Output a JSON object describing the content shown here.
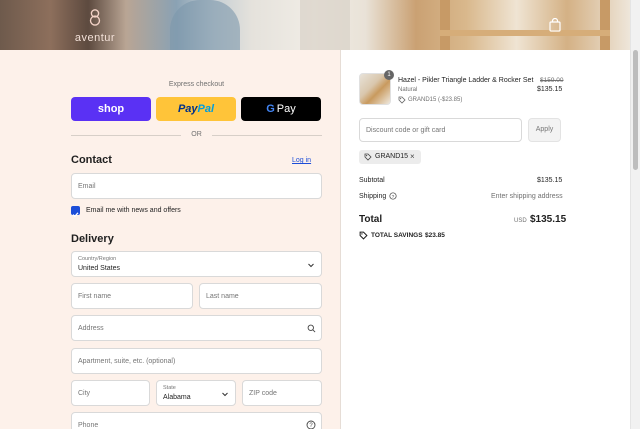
{
  "header": {
    "brand": "aventur",
    "cart_icon": "shopping-bag-icon"
  },
  "express": {
    "label": "Express checkout",
    "shop_label": "shop",
    "paypal_label_1": "Pay",
    "paypal_label_2": "Pal",
    "gpay_g": "G",
    "gpay_label": "Pay",
    "or_label": "OR"
  },
  "contact": {
    "heading": "Contact",
    "login_link": "Log in",
    "email_placeholder": "Email",
    "newsletter_label": "Email me with news and offers",
    "newsletter_checked": true
  },
  "delivery": {
    "heading": "Delivery",
    "country_label": "Country/Region",
    "country_value": "United States",
    "first_name_placeholder": "First name",
    "last_name_placeholder": "Last name",
    "address_placeholder": "Address",
    "apartment_placeholder": "Apartment, suite, etc. (optional)",
    "city_placeholder": "City",
    "state_label": "State",
    "state_value": "Alabama",
    "zip_placeholder": "ZIP code",
    "phone_placeholder": "Phone"
  },
  "summary": {
    "item": {
      "quantity": "1",
      "name": "Hazel - Pikler Triangle Ladder & Rocker Set",
      "variant": "Natural",
      "discount_tag": "GRAND15 (-$23.85)",
      "original_price": "$159.00",
      "price": "$135.15"
    },
    "discount_placeholder": "Discount code or gift card",
    "apply_label": "Apply",
    "applied_code": "GRAND15",
    "subtotal_label": "Subtotal",
    "subtotal_value": "$135.15",
    "shipping_label": "Shipping",
    "shipping_value": "Enter shipping address",
    "total_label": "Total",
    "currency": "USD",
    "total_value": "$135.15",
    "savings_label": "TOTAL SAVINGS",
    "savings_value": "$23.85"
  },
  "colors": {
    "accent": "#1d4ed8",
    "shop": "#5a31f4",
    "paypal": "#ffc439",
    "left_bg": "#fdf1ea"
  }
}
